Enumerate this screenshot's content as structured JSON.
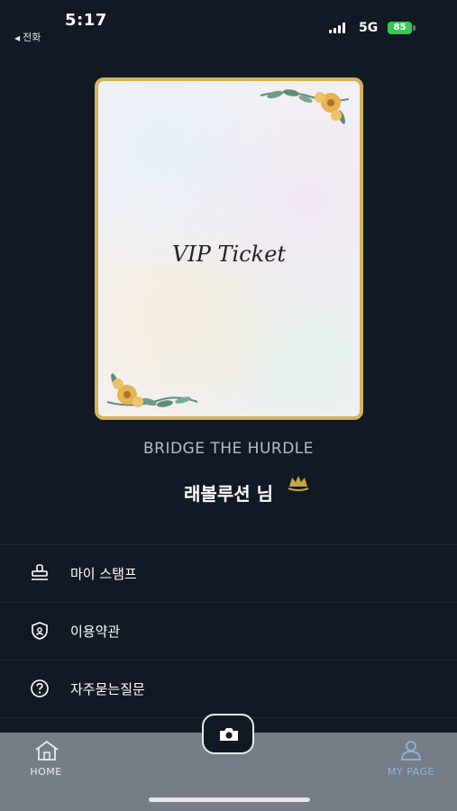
{
  "status_bar": {
    "time": "5:17",
    "back_label": "전화",
    "network": "5G",
    "battery": "85"
  },
  "ticket": {
    "title": "VIP Ticket"
  },
  "profile": {
    "organization": "BRIDGE THE HURDLE",
    "name": "래볼루션 님"
  },
  "menu": {
    "items": [
      {
        "label": "마이 스탬프",
        "icon": "stamp-icon"
      },
      {
        "label": "이용약관",
        "icon": "shield-icon"
      },
      {
        "label": "자주묻는질문",
        "icon": "question-icon"
      }
    ]
  },
  "tabbar": {
    "home_label": "HOME",
    "mypage_label": "MY PAGE",
    "active_tab": "MY PAGE",
    "camera_icon": "camera-icon"
  },
  "colors": {
    "background": "#111a24",
    "ticket_border": "#d6b25a",
    "tabbar": "#767d86",
    "active_tab": "#8fb4e0",
    "battery": "#34c759"
  }
}
